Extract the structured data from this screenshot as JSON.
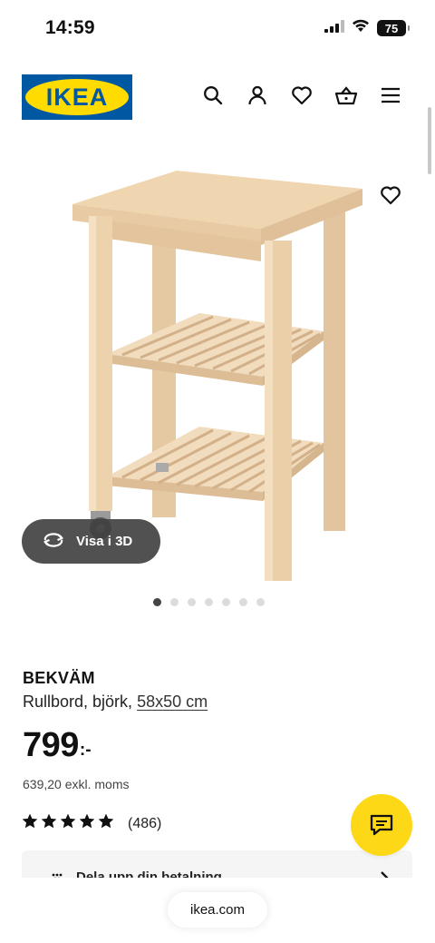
{
  "status_bar": {
    "time": "14:59",
    "battery": "75",
    "icons": [
      "cellular-signal-icon",
      "wifi-icon",
      "battery-icon"
    ]
  },
  "header": {
    "logo_text": "IKEA",
    "brand_colors": {
      "blue": "#0058a3",
      "yellow": "#ffdb00"
    },
    "icons": [
      "search-icon",
      "account-icon",
      "wishlist-icon",
      "basket-icon",
      "menu-icon"
    ]
  },
  "gallery": {
    "view_3d_label": "Visa i 3D",
    "image_count": 7,
    "active_index": 0
  },
  "product": {
    "name": "BEKVÄM",
    "description": "Rullbord, björk,",
    "size_link": "58x50 cm",
    "price": "799",
    "price_suffix": ":-",
    "price_excl_vat": "639,20 exkl. moms",
    "rating": 5,
    "review_count": "(486)"
  },
  "installment": {
    "label": "Dela upp din betalning"
  },
  "browser": {
    "url": "ikea.com"
  },
  "colors": {
    "chat_button": "#fdd816",
    "view3d_bg": "#424242"
  }
}
